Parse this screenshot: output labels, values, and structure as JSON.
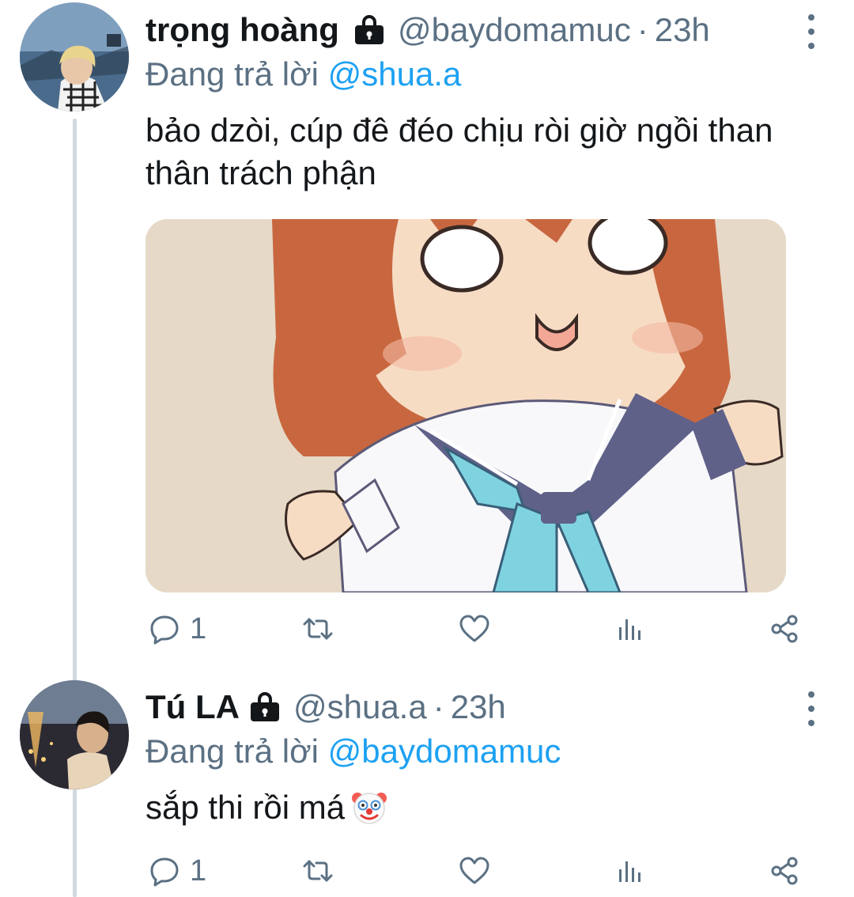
{
  "tweets": [
    {
      "name": "trọng hoàng",
      "handle": "@baydomamuc",
      "separator": "·",
      "time": "23h",
      "reply_prefix": "Đang trả lời",
      "reply_to": "@shua.a",
      "text": "bảo dzòi, cúp đê đéo chịu ròi giờ ngồi than thân trách phận",
      "reply_count": "1",
      "has_media": true,
      "icons": [
        "lock-icon",
        "more-icon",
        "reply-icon",
        "retweet-icon",
        "like-icon",
        "views-icon",
        "share-icon"
      ]
    },
    {
      "name": "Tú LA",
      "handle": "@shua.a",
      "separator": "·",
      "time": "23h",
      "reply_prefix": "Đang trả lời",
      "reply_to": "@baydomamuc",
      "text": "sắp thi rồi má",
      "emoji": "clown-face-emoji",
      "reply_count": "1",
      "icons": [
        "lock-icon",
        "more-icon",
        "reply-icon",
        "retweet-icon",
        "like-icon",
        "views-icon",
        "share-icon"
      ]
    }
  ],
  "colors": {
    "text": "#14171a",
    "secondary": "#5b7083",
    "link": "#1da1f2",
    "thread_line": "#cfd9de"
  }
}
